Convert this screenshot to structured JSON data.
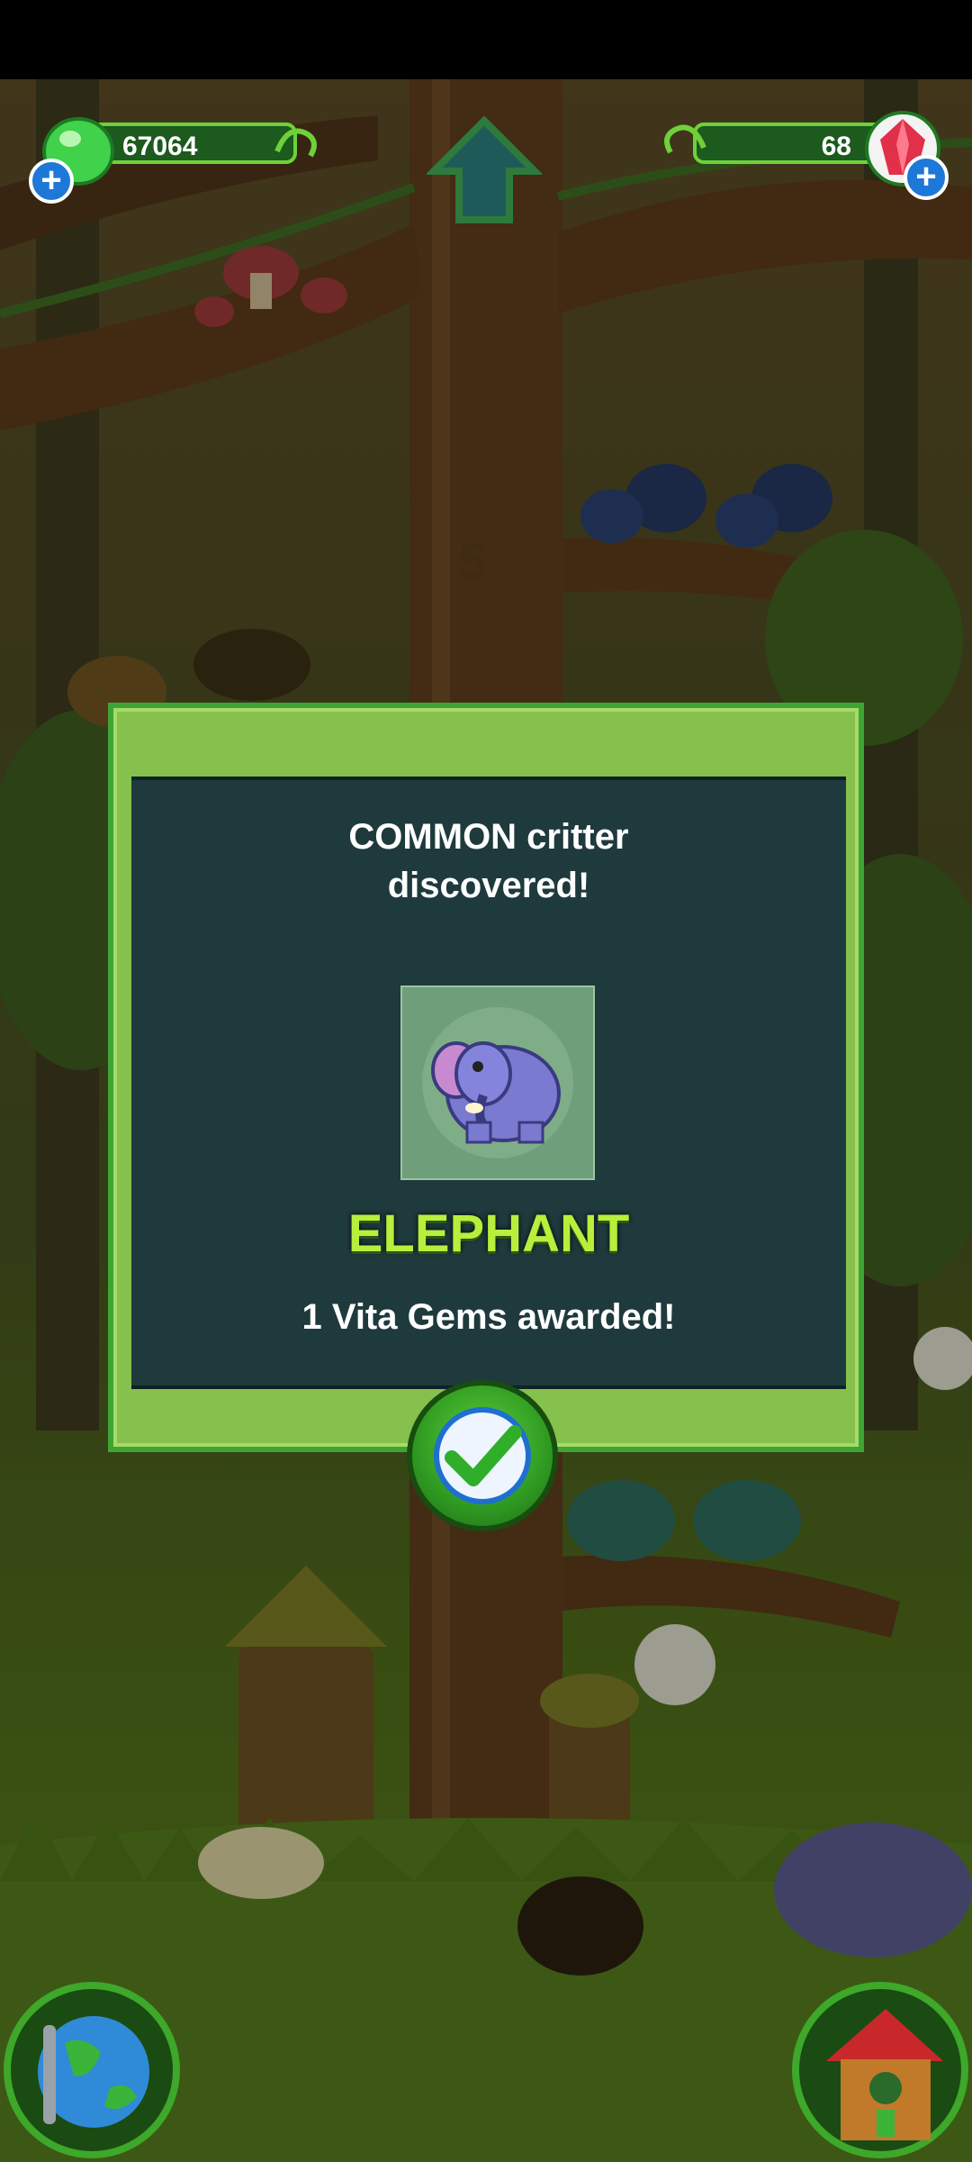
{
  "hud": {
    "slime_count": "67064",
    "gem_count": "68"
  },
  "dialog": {
    "rarity_message": "COMMON critter",
    "rarity_message_line2": "discovered!",
    "critter_name": "ELEPHANT",
    "reward_message": "1 Vita Gems awarded!"
  },
  "tree_marker": "5",
  "icons": {
    "slime": "green-slime-icon",
    "gem": "red-gem-icon",
    "add": "plus-icon",
    "up": "up-arrow-icon",
    "confirm": "checkmark-icon",
    "world": "globe-icon",
    "home": "birdhouse-icon"
  },
  "colors": {
    "dialog_frame": "#86c14e",
    "dialog_panel": "#1e3a3c",
    "critter_name": "#b8ee3c",
    "hud_bar": "#1d5a1d",
    "plus_button": "#1e78d8"
  }
}
